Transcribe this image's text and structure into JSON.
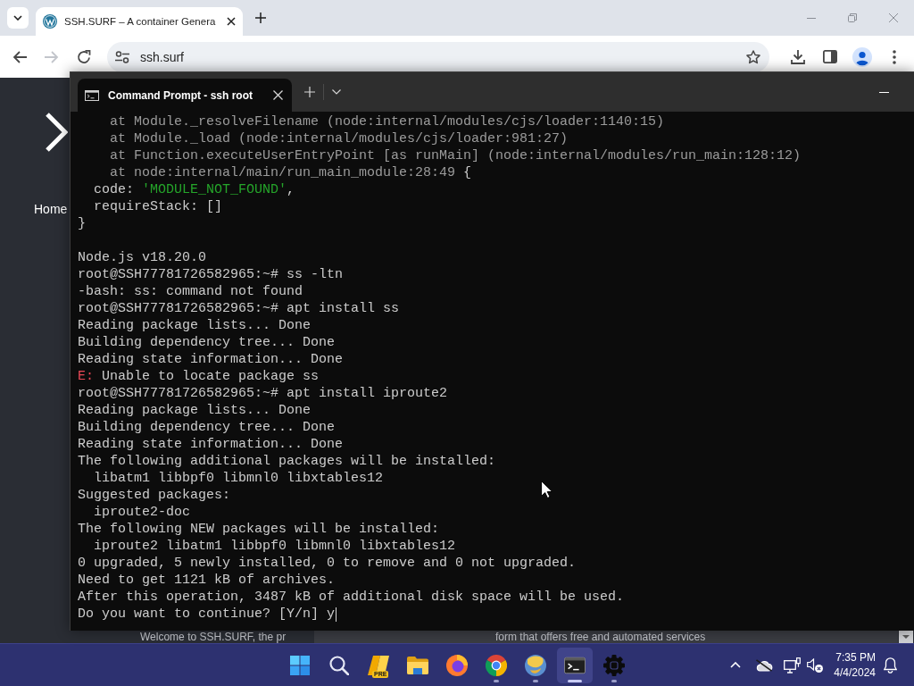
{
  "browser": {
    "tabs": [
      {
        "title": "SSH.SURF – A container Genera",
        "selected": true
      }
    ],
    "back": {
      "disabled": false
    },
    "forward": {
      "disabled": true
    },
    "address": "ssh.surf",
    "page": {
      "nav_label": "Home",
      "footer": [
        "Welcome to SSH.SURF, the pr",
        "form that offers free and automated services"
      ]
    }
  },
  "terminal": {
    "tabs": [
      {
        "title": "Command Prompt - ssh root",
        "selected": true
      }
    ],
    "lines": [
      {
        "kind": "dim",
        "text": "    at Module._resolveFilename (node:internal/modules/cjs/loader:1140:15)"
      },
      {
        "kind": "dim",
        "text": "    at Module._load (node:internal/modules/cjs/loader:981:27)"
      },
      {
        "kind": "dim",
        "text": "    at Function.executeUserEntryPoint [as runMain] (node:internal/modules/run_main:128:12)"
      },
      {
        "kind": "mixed",
        "parts": [
          {
            "text": "    at node:internal/main/run_main_module:28:49 ",
            "kind": "dim"
          },
          {
            "text": "{",
            "kind": "normal"
          }
        ]
      },
      {
        "kind": "mixed",
        "parts": [
          {
            "text": "  code: ",
            "kind": "normal"
          },
          {
            "text": "'MODULE_NOT_FOUND'",
            "kind": "string"
          },
          {
            "text": ",",
            "kind": "normal"
          }
        ]
      },
      {
        "kind": "normal",
        "text": "  requireStack: []"
      },
      {
        "kind": "normal",
        "text": "}"
      },
      {
        "kind": "blank"
      },
      {
        "kind": "normal",
        "text": "Node.js v18.20.0"
      },
      {
        "kind": "normal",
        "text": "root@SSH77781726582965:~# ss -ltn"
      },
      {
        "kind": "normal",
        "text": "-bash: ss: command not found"
      },
      {
        "kind": "normal",
        "text": "root@SSH77781726582965:~# apt install ss"
      },
      {
        "kind": "normal",
        "text": "Reading package lists... Done"
      },
      {
        "kind": "normal",
        "text": "Building dependency tree... Done"
      },
      {
        "kind": "normal",
        "text": "Reading state information... Done"
      },
      {
        "kind": "mixed",
        "parts": [
          {
            "text": "E:",
            "kind": "error"
          },
          {
            "text": " Unable to locate package ss",
            "kind": "normal"
          }
        ]
      },
      {
        "kind": "normal",
        "text": "root@SSH77781726582965:~# apt install iproute2"
      },
      {
        "kind": "normal",
        "text": "Reading package lists... Done"
      },
      {
        "kind": "normal",
        "text": "Building dependency tree... Done"
      },
      {
        "kind": "normal",
        "text": "Reading state information... Done"
      },
      {
        "kind": "normal",
        "text": "The following additional packages will be installed:"
      },
      {
        "kind": "normal",
        "text": "  libatm1 libbpf0 libmnl0 libxtables12"
      },
      {
        "kind": "normal",
        "text": "Suggested packages:"
      },
      {
        "kind": "normal",
        "text": "  iproute2-doc"
      },
      {
        "kind": "normal",
        "text": "The following NEW packages will be installed:"
      },
      {
        "kind": "normal",
        "text": "  iproute2 libatm1 libbpf0 libmnl0 libxtables12"
      },
      {
        "kind": "normal",
        "text": "0 upgraded, 5 newly installed, 0 to remove and 0 not upgraded."
      },
      {
        "kind": "normal",
        "text": "Need to get 1121 kB of archives."
      },
      {
        "kind": "normal",
        "text": "After this operation, 3487 kB of additional disk space will be used."
      },
      {
        "kind": "normal",
        "text": "Do you want to continue? [Y/n] y"
      }
    ]
  },
  "taskbar": {
    "apps": [
      {
        "kind": "start",
        "running": false,
        "selected": false
      },
      {
        "kind": "search",
        "running": false,
        "selected": false
      },
      {
        "kind": "notes",
        "badge": "PRE",
        "running": false,
        "selected": false
      },
      {
        "kind": "folder",
        "running": false,
        "selected": false
      },
      {
        "kind": "fox",
        "running": false,
        "selected": false
      },
      {
        "kind": "wheel",
        "running": true,
        "selected": false
      },
      {
        "kind": "globe",
        "running": true,
        "selected": false
      },
      {
        "kind": "terminal",
        "running": true,
        "selected": true
      },
      {
        "kind": "gear",
        "running": true,
        "selected": false
      }
    ],
    "clock": {
      "time": "7:35 PM",
      "date": "4/4/2024"
    }
  }
}
